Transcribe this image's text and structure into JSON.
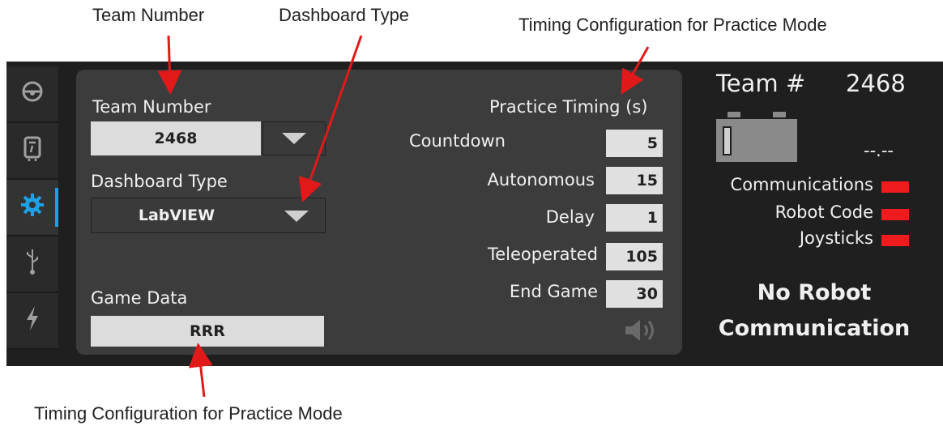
{
  "callouts": {
    "team_number": "Team Number",
    "dashboard_type": "Dashboard Type",
    "timing_top": "Timing Configuration for Practice Mode",
    "timing_bottom": "Timing Configuration for Practice Mode"
  },
  "sidebar": {
    "tabs": [
      {
        "icon": "steering-wheel-icon",
        "glyph": "⊖"
      },
      {
        "icon": "diagnostics-icon",
        "glyph": "▯"
      },
      {
        "icon": "gear-icon",
        "glyph": "✹",
        "active": true
      },
      {
        "icon": "usb-icon",
        "glyph": "⫯"
      },
      {
        "icon": "power-icon",
        "glyph": "ϟ"
      }
    ]
  },
  "setup": {
    "team_number_label": "Team Number",
    "team_number_value": "2468",
    "dashboard_type_label": "Dashboard Type",
    "dashboard_type_value": "LabVIEW",
    "game_data_label": "Game Data",
    "game_data_value": "RRR"
  },
  "timing": {
    "header": "Practice  Timing (s)",
    "rows": [
      {
        "label": "Countdown",
        "value": "5"
      },
      {
        "label": "Autonomous",
        "value": "15"
      },
      {
        "label": "Delay",
        "value": "1"
      },
      {
        "label": "Teleoperated",
        "value": "105"
      },
      {
        "label": "End Game",
        "value": "30"
      }
    ],
    "sound_icon": "speaker-icon"
  },
  "status": {
    "team_label": "Team #",
    "team_value": "2468",
    "battery_voltage": "--.--",
    "indicators": [
      {
        "label": "Communications",
        "color": "#ee1c1c"
      },
      {
        "label": "Robot Code",
        "color": "#ee1c1c"
      },
      {
        "label": "Joysticks",
        "color": "#ee1c1c"
      }
    ],
    "message_line1": "No Robot",
    "message_line2": "Communication"
  },
  "colors": {
    "accent": "#1da1e6",
    "indicator_off": "#ee1c1c",
    "arrow": "#e11919"
  }
}
